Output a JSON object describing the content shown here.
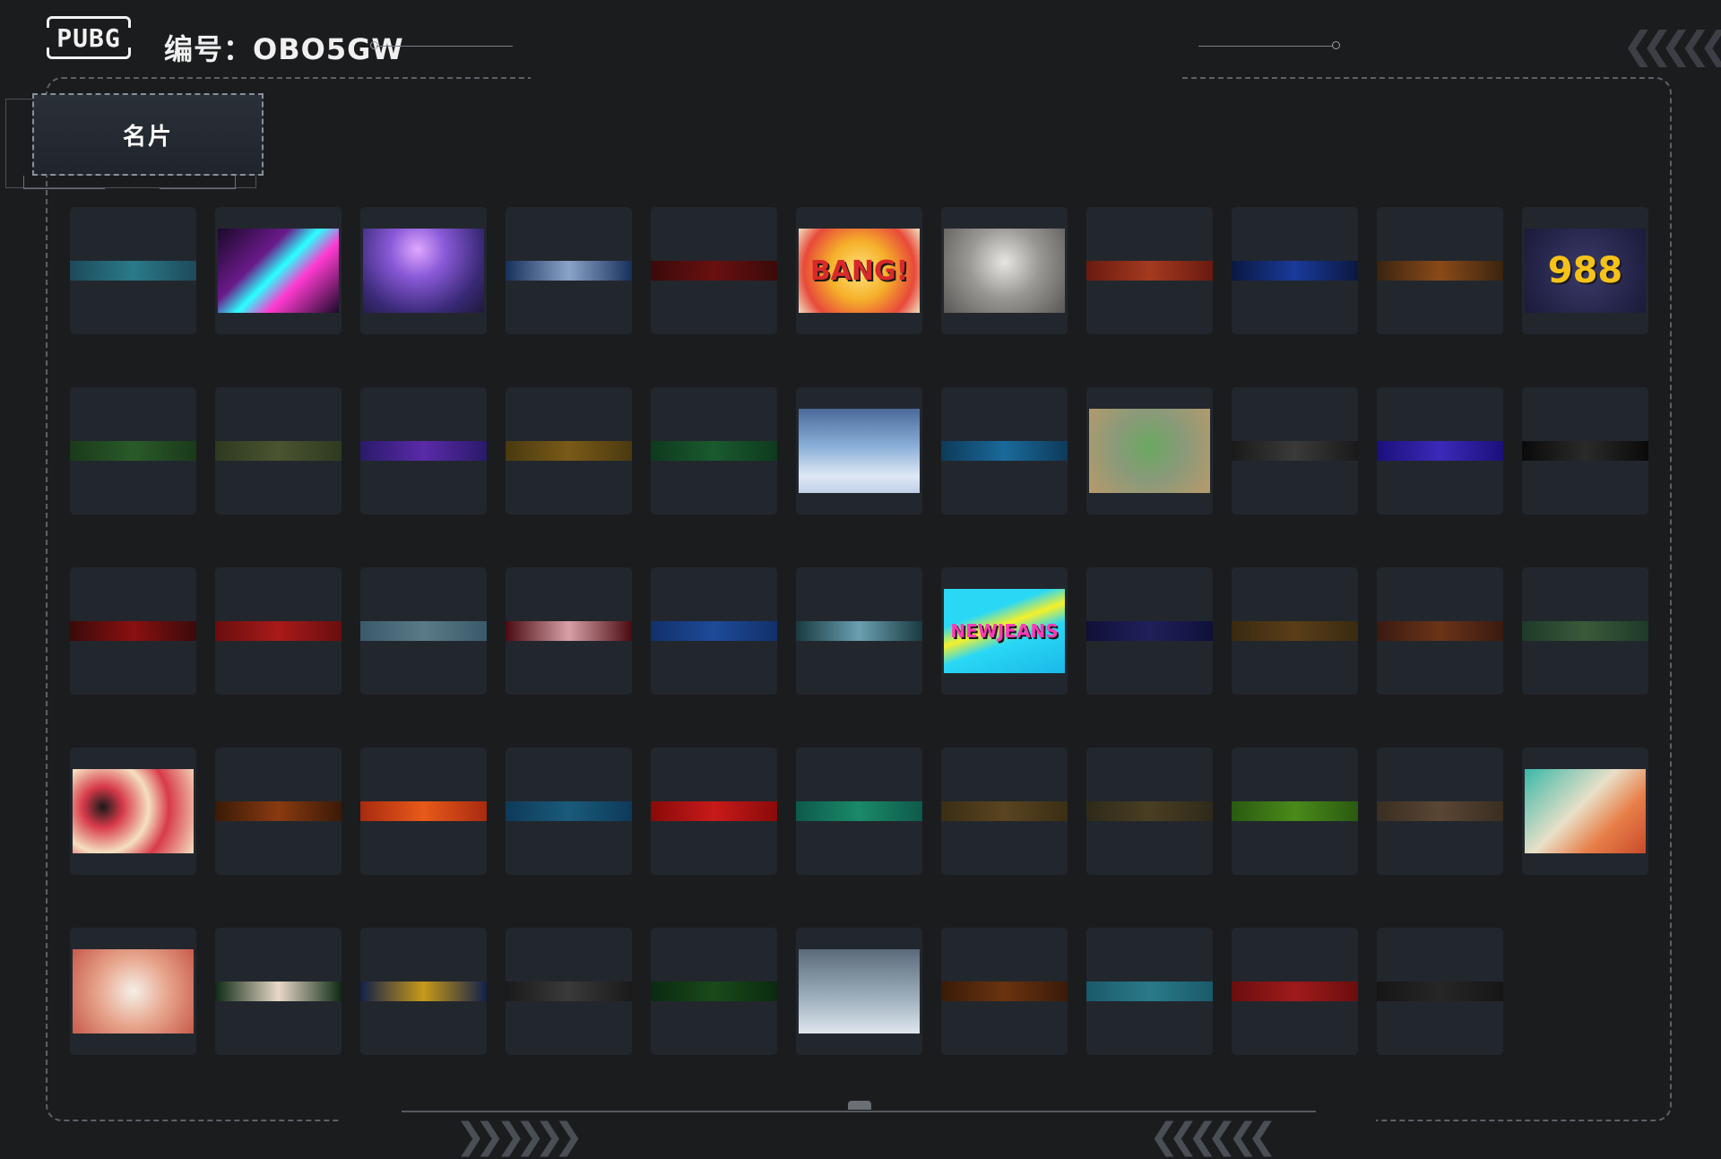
{
  "header": {
    "logo_text": "PUBG",
    "id_prefix": "编号：",
    "id_value": "OBO5GW"
  },
  "tabs": [
    {
      "label": "名片",
      "active": true
    }
  ],
  "decor": {
    "top_right_chevrons": "❮❮❮❮ ❮",
    "bottom_left_chevrons": "❯❯ ❯❯❯❯",
    "bottom_right_chevrons": "❮❮❮❮ ❮❮"
  },
  "cards": [
    {
      "kind": "strip",
      "color": "#1d4a5a",
      "accent": "#2a7a8a"
    },
    {
      "kind": "image",
      "label": "",
      "bg": "linear-gradient(135deg,#1a0a2a 0%,#6a1a8a 35%,#2affff 50%,#ff3ad0 65%,#1a0a2a 100%)"
    },
    {
      "kind": "image",
      "label": "",
      "bg": "radial-gradient(circle at 45% 25%,#e0a8ff 0%,#8a5ad8 30%,#3a2a78 70%,#20183a 100%)"
    },
    {
      "kind": "strip",
      "color": "#17305a",
      "accent": "#8aa4c8"
    },
    {
      "kind": "strip",
      "color": "#3a0a0a",
      "accent": "#6a1010"
    },
    {
      "kind": "image",
      "label": "BANG!",
      "bg": "radial-gradient(circle,#ffe27a 0%,#f5b02a 40%,#e84a3a 75%,#f0e0c0 100%)",
      "color": "#d82a2a",
      "size": "30px"
    },
    {
      "kind": "image",
      "label": "",
      "bg": "radial-gradient(circle at 50% 40%,#e8e6e2 0%,#9a9894 45%,#5a5856 100%)"
    },
    {
      "kind": "strip",
      "color": "#6a1a10",
      "accent": "#a33a20"
    },
    {
      "kind": "strip",
      "color": "#0a1840",
      "accent": "#1a3a9a"
    },
    {
      "kind": "strip",
      "color": "#3a2410",
      "accent": "#8a4a18"
    },
    {
      "kind": "image",
      "label": "988",
      "bg": "radial-gradient(circle,#3a3a6a 0%,#1a1a3a 100%)",
      "color": "#f5c21a",
      "size": "40px"
    },
    {
      "kind": "strip",
      "color": "#1a3a1a",
      "accent": "#2a5a2a"
    },
    {
      "kind": "strip",
      "color": "#2e3a20",
      "accent": "#4a5430"
    },
    {
      "kind": "strip",
      "color": "#2a1a6a",
      "accent": "#5a2aa8"
    },
    {
      "kind": "strip",
      "color": "#4a3a10",
      "accent": "#7a5a18"
    },
    {
      "kind": "strip",
      "color": "#0e3a1e",
      "accent": "#1a5a2e"
    },
    {
      "kind": "image",
      "label": "",
      "bg": "linear-gradient(180deg,#4a6a9a 0%,#8ab0d8 45%,#dfe8f4 80%,#c0d0e8 100%)"
    },
    {
      "kind": "strip",
      "color": "#0e3a5a",
      "accent": "#1a6a9a"
    },
    {
      "kind": "image",
      "label": "",
      "bg": "radial-gradient(circle at 50% 45%,#6aa860 0%,#8a9a7a 45%,#b89a6a 100%)"
    },
    {
      "kind": "strip",
      "color": "#1a1a1a",
      "accent": "#3a3a3a"
    },
    {
      "kind": "strip",
      "color": "#1a107a",
      "accent": "#3a2ab8"
    },
    {
      "kind": "strip",
      "color": "#0a0a0a",
      "accent": "#2a2a2a"
    },
    {
      "kind": "strip",
      "color": "#3a0a0a",
      "accent": "#8a1010"
    },
    {
      "kind": "strip",
      "color": "#6a0e0e",
      "accent": "#a81a1a"
    },
    {
      "kind": "strip",
      "color": "#3a5a6a",
      "accent": "#5a7a88"
    },
    {
      "kind": "strip",
      "color": "#4a0a10",
      "accent": "#d8a0a8"
    },
    {
      "kind": "strip",
      "color": "#12306a",
      "accent": "#1e4a98"
    },
    {
      "kind": "strip",
      "color": "#1a3a40",
      "accent": "#6aa0b0"
    },
    {
      "kind": "image",
      "label": "NEWJEANS",
      "bg": "linear-gradient(160deg,#2ad8f5 0%,#2ad8f5 30%,#f5f02a 45%,#2ad8f5 60%,#1ab8e8 100%)",
      "color": "#ff3ab8",
      "size": "20px"
    },
    {
      "kind": "strip",
      "color": "#10103a",
      "accent": "#20205a"
    },
    {
      "kind": "strip",
      "color": "#3a2a10",
      "accent": "#5a3e18"
    },
    {
      "kind": "strip",
      "color": "#3a1a10",
      "accent": "#6a3418"
    },
    {
      "kind": "strip",
      "color": "#1e3a2a",
      "accent": "#3a5a3a"
    },
    {
      "kind": "image",
      "label": "",
      "bg": "radial-gradient(circle at 25% 45%,#1a1a1a 0%,#d83a4a 20%,#f5e0c0 45%,#d83a4a 65%,#f5e0c0 100%)"
    },
    {
      "kind": "strip",
      "color": "#3a1a08",
      "accent": "#8a3a10"
    },
    {
      "kind": "strip",
      "color": "#a82a10",
      "accent": "#e85a18"
    },
    {
      "kind": "strip",
      "color": "#0e3a5a",
      "accent": "#1a5a7a"
    },
    {
      "kind": "strip",
      "color": "#8a0a0a",
      "accent": "#c81a1a"
    },
    {
      "kind": "strip",
      "color": "#0e5a4a",
      "accent": "#1a8a6a"
    },
    {
      "kind": "strip",
      "color": "#3a2e14",
      "accent": "#5a4420"
    },
    {
      "kind": "strip",
      "color": "#2e2a1a",
      "accent": "#4a3e22"
    },
    {
      "kind": "strip",
      "color": "#2a5a10",
      "accent": "#4a8a1a"
    },
    {
      "kind": "strip",
      "color": "#3a2e22",
      "accent": "#5a4634"
    },
    {
      "kind": "image",
      "label": "",
      "bg": "linear-gradient(135deg,#3ab8a8 0%,#e8e0c8 45%,#e8804a 70%,#c84a2a 100%)"
    },
    {
      "kind": "image",
      "label": "",
      "bg": "radial-gradient(circle at 50% 50%,#f5f0e8 0%,#e8a890 45%,#c85a4a 100%)"
    },
    {
      "kind": "strip",
      "color": "#0e2a14",
      "accent": "#e8d8c8"
    },
    {
      "kind": "strip",
      "color": "#12204a",
      "accent": "#c89a18"
    },
    {
      "kind": "strip",
      "color": "#1a1a1a",
      "accent": "#3a3a3a"
    },
    {
      "kind": "strip",
      "color": "#0a2a10",
      "accent": "#1a4a1a"
    },
    {
      "kind": "image",
      "label": "",
      "bg": "linear-gradient(180deg,#5a6a7a 0%,#9aacba 55%,#dfe6ec 100%)"
    },
    {
      "kind": "strip",
      "color": "#3a1a08",
      "accent": "#6a3410"
    },
    {
      "kind": "strip",
      "color": "#1a5a6a",
      "accent": "#2a7a8a"
    },
    {
      "kind": "strip",
      "color": "#6a0e0e",
      "accent": "#a01a1a"
    },
    {
      "kind": "strip",
      "color": "#161616",
      "accent": "#262626"
    }
  ]
}
